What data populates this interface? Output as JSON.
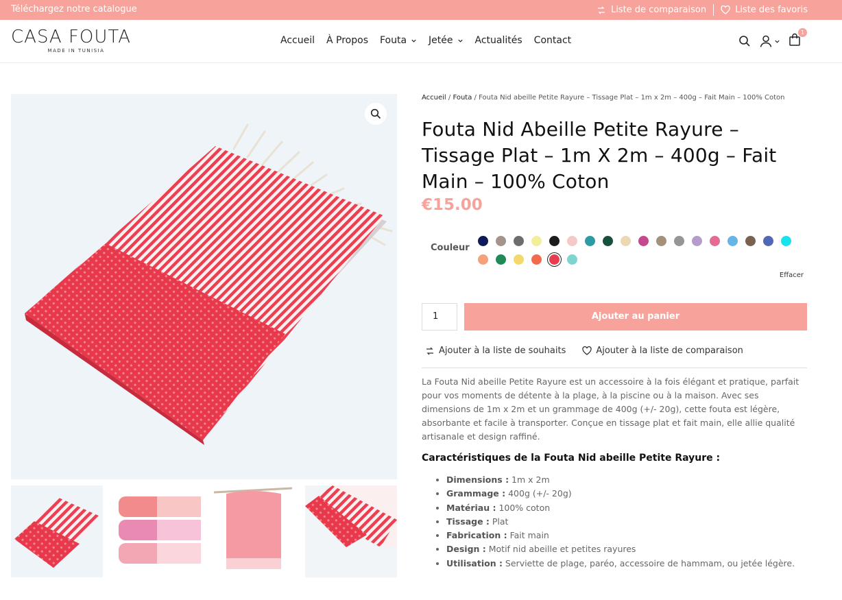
{
  "topbar": {
    "catalog": "Téléchargez notre catalogue",
    "compare": "Liste de comparaison",
    "favorites": "Liste des favoris"
  },
  "header": {
    "logo": "CASA FOUTA",
    "logo_tagline": "MADE IN TUNISIA",
    "nav": [
      "Accueil",
      "À Propos",
      "Fouta",
      "Jetée",
      "Actualités",
      "Contact"
    ],
    "cart_count": "1"
  },
  "breadcrumb": {
    "home": "Accueil",
    "category": "Fouta",
    "current": "/ Fouta Nid abeille Petite Rayure – Tissage Plat – 1m x 2m – 400g – Fait Main – 100% Coton"
  },
  "product": {
    "title": "Fouta Nid Abeille Petite Rayure – Tissage Plat – 1m X 2m – 400g – Fait Main – 100% Coton",
    "price": "€15.00",
    "variation_label": "Couleur",
    "swatches": [
      "#0d1b5c",
      "#a5948a",
      "#6d6d6d",
      "#f2ee9a",
      "#1c1c1c",
      "#f6c9c9",
      "#2e9aa6",
      "#16513c",
      "#ecd9b4",
      "#c5478c",
      "#a5907c",
      "#969696",
      "#b49ccd",
      "#e56b93",
      "#67b4e6",
      "#7a6152",
      "#5068b5",
      "#17e3f0",
      "#f4a17c",
      "#1f8b59",
      "#f5d86c",
      "#f36a4c",
      "#e83c4f",
      "#7ed5cf"
    ],
    "selected_swatch": 22,
    "clear_label": "Effacer",
    "quantity": "1",
    "add_to_cart": "Ajouter au panier",
    "wishlist": "Ajouter à la liste de souhaits",
    "compare": "Ajouter à la liste de comparaison",
    "description": "La Fouta Nid abeille Petite Rayure est un accessoire à la fois élégant et pratique, parfait pour vos moments de détente à la plage, à la piscine ou à la maison. Avec ses dimensions de 1m x 2m et un grammage de 400g (+/- 20g), cette fouta est légère, absorbante et facile à transporter. Conçue en tissage plat et fait main, elle allie qualité artisanale et design raffiné.",
    "features_title": "Caractéristiques de la Fouta Nid abeille Petite Rayure :",
    "features": [
      {
        "k": "Dimensions :",
        "v": " 1m x 2m"
      },
      {
        "k": "Grammage :",
        "v": " 400g (+/- 20g)"
      },
      {
        "k": "Matériau :",
        "v": " 100% coton"
      },
      {
        "k": "Tissage :",
        "v": " Plat"
      },
      {
        "k": "Fabrication :",
        "v": " Fait main"
      },
      {
        "k": "Design :",
        "v": " Motif nid abeille et petites rayures"
      },
      {
        "k": "Utilisation :",
        "v": " Serviette de plage, paréo, accessoire de hammam, ou jetée légère."
      }
    ]
  },
  "colors": {
    "accent": "#f7a39b",
    "towel_red": "#ec3f52"
  }
}
